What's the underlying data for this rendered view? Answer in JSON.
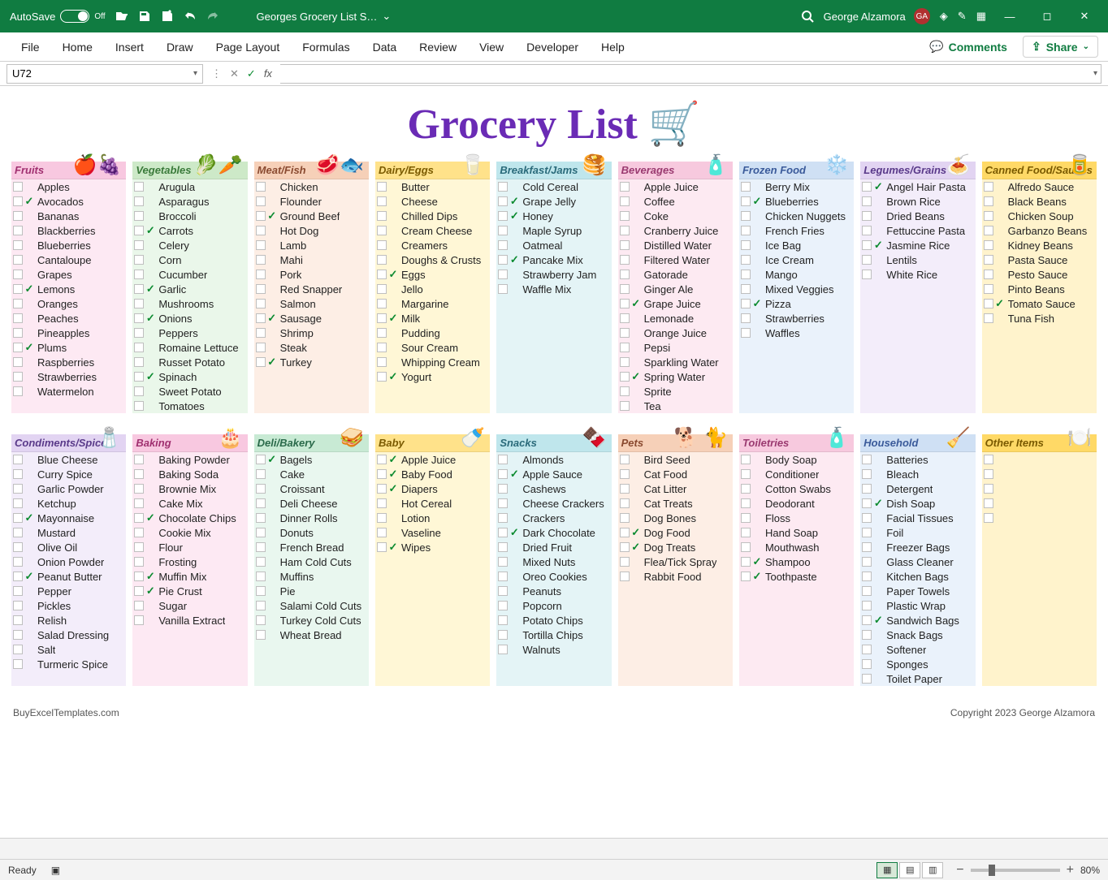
{
  "titlebar": {
    "autosave_label": "AutoSave",
    "autosave_state": "Off",
    "file_name": "Georges Grocery List S…",
    "user_name": "George Alzamora",
    "user_initials": "GA"
  },
  "ribbon": {
    "tabs": [
      "File",
      "Home",
      "Insert",
      "Draw",
      "Page Layout",
      "Formulas",
      "Data",
      "Review",
      "View",
      "Developer",
      "Help"
    ],
    "comments": "Comments",
    "share": "Share"
  },
  "formula": {
    "cellref": "U72",
    "fx": "fx"
  },
  "doc_title": "Grocery List 🛒",
  "footer": {
    "left": "BuyExcelTemplates.com",
    "right": "Copyright 2023 George Alzamora"
  },
  "statusbar": {
    "ready": "Ready",
    "zoom": "80%"
  },
  "row1": [
    {
      "name": "Fruits",
      "emoji": "🍎🍇",
      "bg": "pink",
      "hd": "pink",
      "items": [
        {
          "t": "Apples",
          "c": 0
        },
        {
          "t": "Avocados",
          "c": 1
        },
        {
          "t": "Bananas",
          "c": 0
        },
        {
          "t": "Blackberries",
          "c": 0
        },
        {
          "t": "Blueberries",
          "c": 0
        },
        {
          "t": "Cantaloupe",
          "c": 0
        },
        {
          "t": "Grapes",
          "c": 0
        },
        {
          "t": "Lemons",
          "c": 1
        },
        {
          "t": "Oranges",
          "c": 0
        },
        {
          "t": "Peaches",
          "c": 0
        },
        {
          "t": "Pineapples",
          "c": 0
        },
        {
          "t": "Plums",
          "c": 1
        },
        {
          "t": "Raspberries",
          "c": 0
        },
        {
          "t": "Strawberries",
          "c": 0
        },
        {
          "t": "Watermelon",
          "c": 0
        }
      ]
    },
    {
      "name": "Vegetables",
      "emoji": "🥬🥕",
      "bg": "green",
      "hd": "green",
      "items": [
        {
          "t": "Arugula",
          "c": 0
        },
        {
          "t": "Asparagus",
          "c": 0
        },
        {
          "t": "Broccoli",
          "c": 0
        },
        {
          "t": "Carrots",
          "c": 1
        },
        {
          "t": "Celery",
          "c": 0
        },
        {
          "t": "Corn",
          "c": 0
        },
        {
          "t": "Cucumber",
          "c": 0
        },
        {
          "t": "Garlic",
          "c": 1
        },
        {
          "t": "Mushrooms",
          "c": 0
        },
        {
          "t": "Onions",
          "c": 1
        },
        {
          "t": "Peppers",
          "c": 0
        },
        {
          "t": "Romaine Lettuce",
          "c": 0
        },
        {
          "t": "Russet Potato",
          "c": 0
        },
        {
          "t": "Spinach",
          "c": 1
        },
        {
          "t": "Sweet Potato",
          "c": 0
        },
        {
          "t": "Tomatoes",
          "c": 0
        }
      ]
    },
    {
      "name": "Meat/Fish",
      "emoji": "🥩🐟",
      "bg": "peach",
      "hd": "peach",
      "items": [
        {
          "t": "Chicken",
          "c": 0
        },
        {
          "t": "Flounder",
          "c": 0
        },
        {
          "t": "Ground Beef",
          "c": 1
        },
        {
          "t": "Hot Dog",
          "c": 0
        },
        {
          "t": "Lamb",
          "c": 0
        },
        {
          "t": "Mahi",
          "c": 0
        },
        {
          "t": "Pork",
          "c": 0
        },
        {
          "t": "Red Snapper",
          "c": 0
        },
        {
          "t": "Salmon",
          "c": 0
        },
        {
          "t": "Sausage",
          "c": 1
        },
        {
          "t": "Shrimp",
          "c": 0
        },
        {
          "t": "Steak",
          "c": 0
        },
        {
          "t": "Turkey",
          "c": 1
        }
      ]
    },
    {
      "name": "Dairy/Eggs",
      "emoji": "🥛",
      "bg": "yellow",
      "hd": "yellow",
      "items": [
        {
          "t": "Butter",
          "c": 0
        },
        {
          "t": "Cheese",
          "c": 0
        },
        {
          "t": "Chilled Dips",
          "c": 0
        },
        {
          "t": "Cream Cheese",
          "c": 0
        },
        {
          "t": "Creamers",
          "c": 0
        },
        {
          "t": "Doughs & Crusts",
          "c": 0
        },
        {
          "t": "Eggs",
          "c": 1
        },
        {
          "t": "Jello",
          "c": 0
        },
        {
          "t": "Margarine",
          "c": 0
        },
        {
          "t": "Milk",
          "c": 1
        },
        {
          "t": "Pudding",
          "c": 0
        },
        {
          "t": "Sour Cream",
          "c": 0
        },
        {
          "t": "Whipping Cream",
          "c": 0
        },
        {
          "t": "Yogurt",
          "c": 1
        }
      ]
    },
    {
      "name": "Breakfast/Jams",
      "emoji": "🥞",
      "bg": "cyan",
      "hd": "cyan",
      "items": [
        {
          "t": "Cold Cereal",
          "c": 0
        },
        {
          "t": "Grape Jelly",
          "c": 1
        },
        {
          "t": "Honey",
          "c": 1
        },
        {
          "t": "Maple Syrup",
          "c": 0
        },
        {
          "t": "Oatmeal",
          "c": 0
        },
        {
          "t": "Pancake Mix",
          "c": 1
        },
        {
          "t": "Strawberry Jam",
          "c": 0
        },
        {
          "t": "Waffle Mix",
          "c": 0
        }
      ]
    },
    {
      "name": "Beverages",
      "emoji": "🧴",
      "bg": "lpink",
      "hd": "lpink",
      "items": [
        {
          "t": "Apple Juice",
          "c": 0
        },
        {
          "t": "Coffee",
          "c": 0
        },
        {
          "t": "Coke",
          "c": 0
        },
        {
          "t": "Cranberry Juice",
          "c": 0
        },
        {
          "t": "Distilled Water",
          "c": 0
        },
        {
          "t": "Filtered Water",
          "c": 0
        },
        {
          "t": "Gatorade",
          "c": 0
        },
        {
          "t": "Ginger Ale",
          "c": 0
        },
        {
          "t": "Grape Juice",
          "c": 1
        },
        {
          "t": "Lemonade",
          "c": 0
        },
        {
          "t": "Orange Juice",
          "c": 0
        },
        {
          "t": "Pepsi",
          "c": 0
        },
        {
          "t": "Sparkling Water",
          "c": 0
        },
        {
          "t": "Spring Water",
          "c": 1
        },
        {
          "t": "Sprite",
          "c": 0
        },
        {
          "t": "Tea",
          "c": 0
        }
      ]
    },
    {
      "name": "Frozen Food",
      "emoji": "❄️",
      "bg": "lblue",
      "hd": "lblue",
      "items": [
        {
          "t": "Berry Mix",
          "c": 0
        },
        {
          "t": "Blueberries",
          "c": 1
        },
        {
          "t": "Chicken Nuggets",
          "c": 0
        },
        {
          "t": "French Fries",
          "c": 0
        },
        {
          "t": "Ice Bag",
          "c": 0
        },
        {
          "t": "Ice Cream",
          "c": 0
        },
        {
          "t": "Mango",
          "c": 0
        },
        {
          "t": "Mixed Veggies",
          "c": 0
        },
        {
          "t": "Pizza",
          "c": 1
        },
        {
          "t": "Strawberries",
          "c": 0
        },
        {
          "t": "Waffles",
          "c": 0
        }
      ]
    },
    {
      "name": "Legumes/Grains",
      "emoji": "🍝",
      "bg": "lav",
      "hd": "lav",
      "items": [
        {
          "t": "Angel Hair Pasta",
          "c": 1
        },
        {
          "t": "Brown Rice",
          "c": 0
        },
        {
          "t": "Dried Beans",
          "c": 0
        },
        {
          "t": "Fettuccine Pasta",
          "c": 0
        },
        {
          "t": "Jasmine Rice",
          "c": 1
        },
        {
          "t": "Lentils",
          "c": 0
        },
        {
          "t": "White Rice",
          "c": 0
        }
      ]
    },
    {
      "name": "Canned Food/Sauces",
      "emoji": "🥫",
      "bg": "gold",
      "hd": "gold",
      "items": [
        {
          "t": "Alfredo Sauce",
          "c": 0
        },
        {
          "t": "Black Beans",
          "c": 0
        },
        {
          "t": "Chicken Soup",
          "c": 0
        },
        {
          "t": "Garbanzo Beans",
          "c": 0
        },
        {
          "t": "Kidney Beans",
          "c": 0
        },
        {
          "t": "Pasta Sauce",
          "c": 0
        },
        {
          "t": "Pesto Sauce",
          "c": 0
        },
        {
          "t": "Pinto Beans",
          "c": 0
        },
        {
          "t": "Tomato Sauce",
          "c": 1
        },
        {
          "t": "Tuna Fish",
          "c": 0
        }
      ]
    }
  ],
  "row2": [
    {
      "name": "Condiments/Spices",
      "emoji": "🧂",
      "bg": "lav",
      "hd": "lav",
      "items": [
        {
          "t": "Blue Cheese",
          "c": 0
        },
        {
          "t": "Curry Spice",
          "c": 0
        },
        {
          "t": "Garlic Powder",
          "c": 0
        },
        {
          "t": "Ketchup",
          "c": 0
        },
        {
          "t": "Mayonnaise",
          "c": 1
        },
        {
          "t": "Mustard",
          "c": 0
        },
        {
          "t": "Olive Oil",
          "c": 0
        },
        {
          "t": "Onion Powder",
          "c": 0
        },
        {
          "t": "Peanut Butter",
          "c": 1
        },
        {
          "t": "Pepper",
          "c": 0
        },
        {
          "t": "Pickles",
          "c": 0
        },
        {
          "t": "Relish",
          "c": 0
        },
        {
          "t": "Salad Dressing",
          "c": 0
        },
        {
          "t": "Salt",
          "c": 0
        },
        {
          "t": "Turmeric Spice",
          "c": 0
        }
      ]
    },
    {
      "name": "Baking",
      "emoji": "🎂",
      "bg": "pink",
      "hd": "pink",
      "items": [
        {
          "t": "Baking Powder",
          "c": 0
        },
        {
          "t": "Baking Soda",
          "c": 0
        },
        {
          "t": "Brownie Mix",
          "c": 0
        },
        {
          "t": "Cake Mix",
          "c": 0
        },
        {
          "t": "Chocolate Chips",
          "c": 1
        },
        {
          "t": "Cookie Mix",
          "c": 0
        },
        {
          "t": "Flour",
          "c": 0
        },
        {
          "t": "Frosting",
          "c": 0
        },
        {
          "t": "Muffin Mix",
          "c": 1
        },
        {
          "t": "Pie Crust",
          "c": 1
        },
        {
          "t": "Sugar",
          "c": 0
        },
        {
          "t": "Vanilla Extract",
          "c": 0
        }
      ]
    },
    {
      "name": "Deli/Bakery",
      "emoji": "🥪",
      "bg": "mint",
      "hd": "mint",
      "items": [
        {
          "t": "Bagels",
          "c": 1
        },
        {
          "t": "Cake",
          "c": 0
        },
        {
          "t": "Croissant",
          "c": 0
        },
        {
          "t": "Deli Cheese",
          "c": 0
        },
        {
          "t": "Dinner Rolls",
          "c": 0
        },
        {
          "t": "Donuts",
          "c": 0
        },
        {
          "t": "French Bread",
          "c": 0
        },
        {
          "t": "Ham Cold Cuts",
          "c": 0
        },
        {
          "t": "Muffins",
          "c": 0
        },
        {
          "t": "Pie",
          "c": 0
        },
        {
          "t": "Salami Cold Cuts",
          "c": 0
        },
        {
          "t": "Turkey Cold Cuts",
          "c": 0
        },
        {
          "t": "Wheat Bread",
          "c": 0
        }
      ]
    },
    {
      "name": "Baby",
      "emoji": "🍼",
      "bg": "yellow",
      "hd": "yellow",
      "items": [
        {
          "t": "Apple Juice",
          "c": 1
        },
        {
          "t": "Baby Food",
          "c": 1
        },
        {
          "t": "Diapers",
          "c": 1
        },
        {
          "t": "Hot Cereal",
          "c": 0
        },
        {
          "t": "Lotion",
          "c": 0
        },
        {
          "t": "Vaseline",
          "c": 0
        },
        {
          "t": "Wipes",
          "c": 1
        }
      ]
    },
    {
      "name": "Snacks",
      "emoji": "🍫",
      "bg": "cyan",
      "hd": "cyan",
      "items": [
        {
          "t": "Almonds",
          "c": 0
        },
        {
          "t": "Apple Sauce",
          "c": 1
        },
        {
          "t": "Cashews",
          "c": 0
        },
        {
          "t": "Cheese Crackers",
          "c": 0
        },
        {
          "t": "Crackers",
          "c": 0
        },
        {
          "t": "Dark Chocolate",
          "c": 1
        },
        {
          "t": "Dried Fruit",
          "c": 0
        },
        {
          "t": "Mixed Nuts",
          "c": 0
        },
        {
          "t": "Oreo Cookies",
          "c": 0
        },
        {
          "t": "Peanuts",
          "c": 0
        },
        {
          "t": "Popcorn",
          "c": 0
        },
        {
          "t": "Potato Chips",
          "c": 0
        },
        {
          "t": "Tortilla Chips",
          "c": 0
        },
        {
          "t": "Walnuts",
          "c": 0
        }
      ]
    },
    {
      "name": "Pets",
      "emoji": "🐕 🐈",
      "bg": "peach",
      "hd": "peach",
      "items": [
        {
          "t": "Bird Seed",
          "c": 0
        },
        {
          "t": "Cat Food",
          "c": 0
        },
        {
          "t": "Cat Litter",
          "c": 0
        },
        {
          "t": "Cat Treats",
          "c": 0
        },
        {
          "t": "Dog Bones",
          "c": 0
        },
        {
          "t": "Dog Food",
          "c": 1
        },
        {
          "t": "Dog Treats",
          "c": 1
        },
        {
          "t": "Flea/Tick Spray",
          "c": 0
        },
        {
          "t": "Rabbit Food",
          "c": 0
        }
      ]
    },
    {
      "name": "Toiletries",
      "emoji": "🧴",
      "bg": "lpink",
      "hd": "lpink",
      "items": [
        {
          "t": "Body Soap",
          "c": 0
        },
        {
          "t": "Conditioner",
          "c": 0
        },
        {
          "t": "Cotton Swabs",
          "c": 0
        },
        {
          "t": "Deodorant",
          "c": 0
        },
        {
          "t": "Floss",
          "c": 0
        },
        {
          "t": "Hand Soap",
          "c": 0
        },
        {
          "t": "Mouthwash",
          "c": 0
        },
        {
          "t": "Shampoo",
          "c": 1
        },
        {
          "t": "Toothpaste",
          "c": 1
        }
      ]
    },
    {
      "name": "Household",
      "emoji": "🧹",
      "bg": "lblue",
      "hd": "lblue",
      "items": [
        {
          "t": "Batteries",
          "c": 0
        },
        {
          "t": "Bleach",
          "c": 0
        },
        {
          "t": "Detergent",
          "c": 0
        },
        {
          "t": "Dish Soap",
          "c": 1
        },
        {
          "t": "Facial Tissues",
          "c": 0
        },
        {
          "t": "Foil",
          "c": 0
        },
        {
          "t": "Freezer Bags",
          "c": 0
        },
        {
          "t": "Glass Cleaner",
          "c": 0
        },
        {
          "t": "Kitchen Bags",
          "c": 0
        },
        {
          "t": "Paper Towels",
          "c": 0
        },
        {
          "t": "Plastic Wrap",
          "c": 0
        },
        {
          "t": "Sandwich Bags",
          "c": 1
        },
        {
          "t": "Snack Bags",
          "c": 0
        },
        {
          "t": "Softener",
          "c": 0
        },
        {
          "t": "Sponges",
          "c": 0
        },
        {
          "t": "Toilet Paper",
          "c": 0
        }
      ]
    },
    {
      "name": "Other Items",
      "emoji": "🍽️",
      "bg": "gold",
      "hd": "gold",
      "items": [
        {
          "t": "",
          "c": 0
        },
        {
          "t": "",
          "c": 0
        },
        {
          "t": "",
          "c": 0
        },
        {
          "t": "",
          "c": 0
        },
        {
          "t": "",
          "c": 0
        }
      ]
    }
  ]
}
